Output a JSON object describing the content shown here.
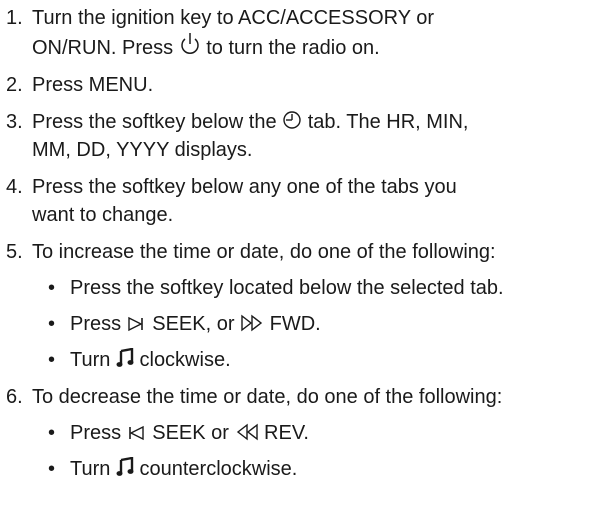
{
  "steps": [
    {
      "num": "1.",
      "line1_a": "Turn the ignition key to ACC/ACCESSORY or",
      "line2_a": "ON/RUN. Press ",
      "power_icon": "power-icon",
      "line2_b": " to turn the radio on."
    },
    {
      "num": "2.",
      "text": "Press MENU."
    },
    {
      "num": "3.",
      "line1_a": "Press the softkey below the ",
      "clock_icon": "clock-icon",
      "line1_b": " tab. The HR, MIN,",
      "line2_a": "MM, DD, YYYY displays."
    },
    {
      "num": "4.",
      "line1_a": "Press the softkey below any one of the tabs you",
      "line2_a": "want to change."
    },
    {
      "num": "5.",
      "text": "To increase the time or date, do one of the following:",
      "bullets": [
        {
          "text": "Press the softkey located below the selected tab."
        },
        {
          "a": "Press ",
          "seek_label": " SEEK, or ",
          "fwd_label": " FWD."
        },
        {
          "a": "Turn ",
          "b": " clockwise."
        }
      ]
    },
    {
      "num": "6.",
      "text": "To decrease the time or date, do one of the following:",
      "bullets": [
        {
          "a": "Press ",
          "seek_label": " SEEK or ",
          "rev_label": " REV."
        },
        {
          "a": "Turn ",
          "b": " counterclockwise."
        }
      ]
    }
  ],
  "bullet_char": "•"
}
